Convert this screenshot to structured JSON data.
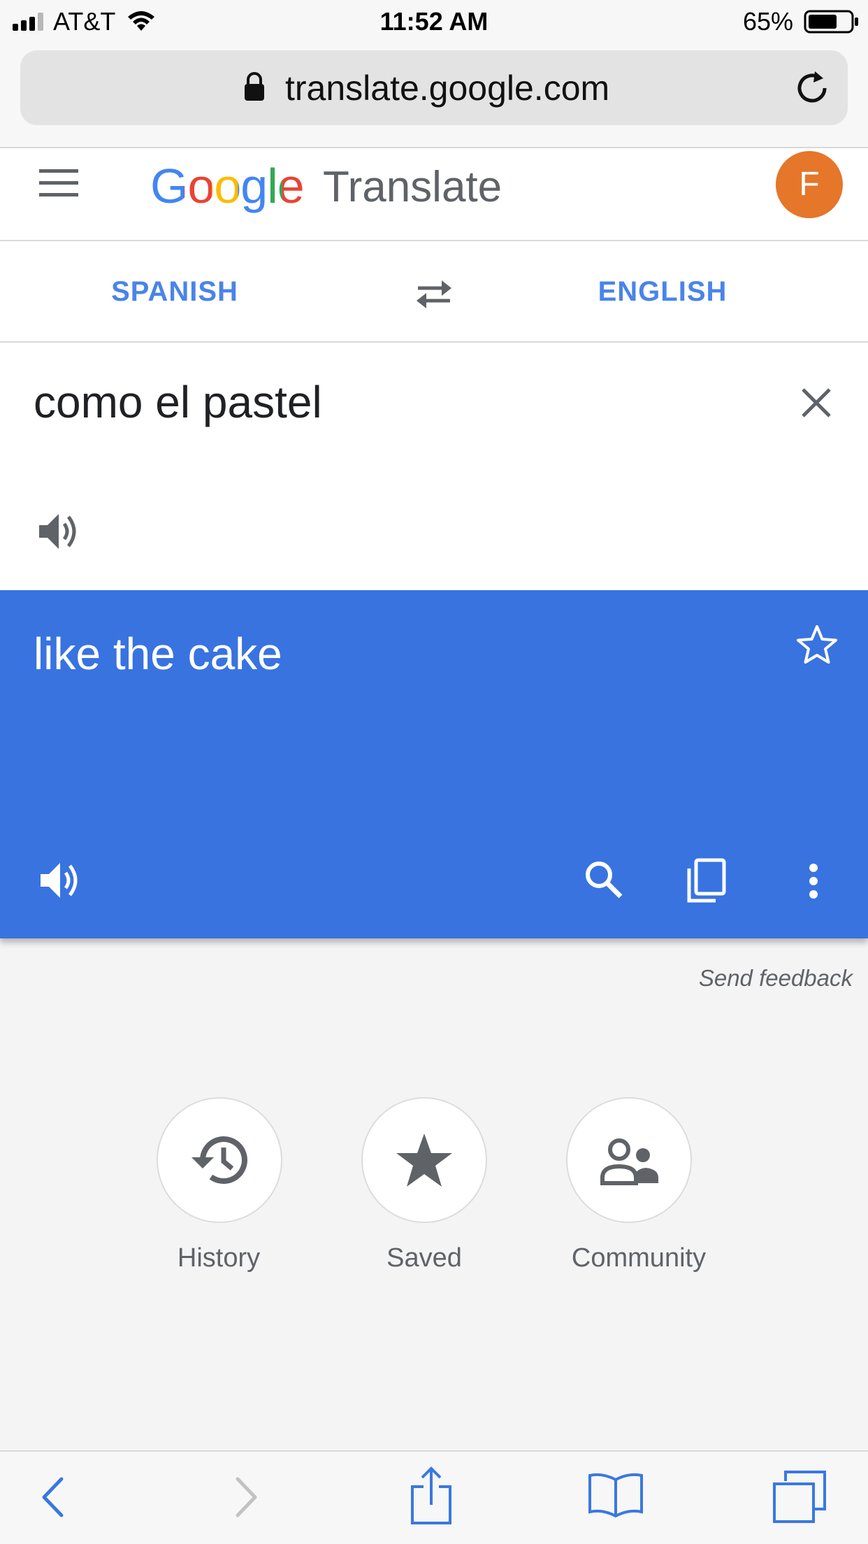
{
  "status_bar": {
    "carrier": "AT&T",
    "time": "11:52 AM",
    "battery": "65%"
  },
  "browser": {
    "url": "translate.google.com"
  },
  "header": {
    "logo": "Google",
    "app_name": "Translate",
    "avatar_letter": "F",
    "avatar_color": "#e5762a"
  },
  "languages": {
    "source": "SPANISH",
    "target": "ENGLISH"
  },
  "input": {
    "text": "como el pastel"
  },
  "output": {
    "text": "like the cake",
    "background": "#3873e0"
  },
  "feedback_label": "Send feedback",
  "quick_actions": [
    {
      "label": "History",
      "icon": "history-icon"
    },
    {
      "label": "Saved",
      "icon": "star-icon"
    },
    {
      "label": "Community",
      "icon": "community-icon"
    }
  ],
  "toolbar": {
    "icons": [
      "back-icon",
      "forward-icon",
      "share-icon",
      "bookmarks-icon",
      "tabs-icon"
    ]
  }
}
